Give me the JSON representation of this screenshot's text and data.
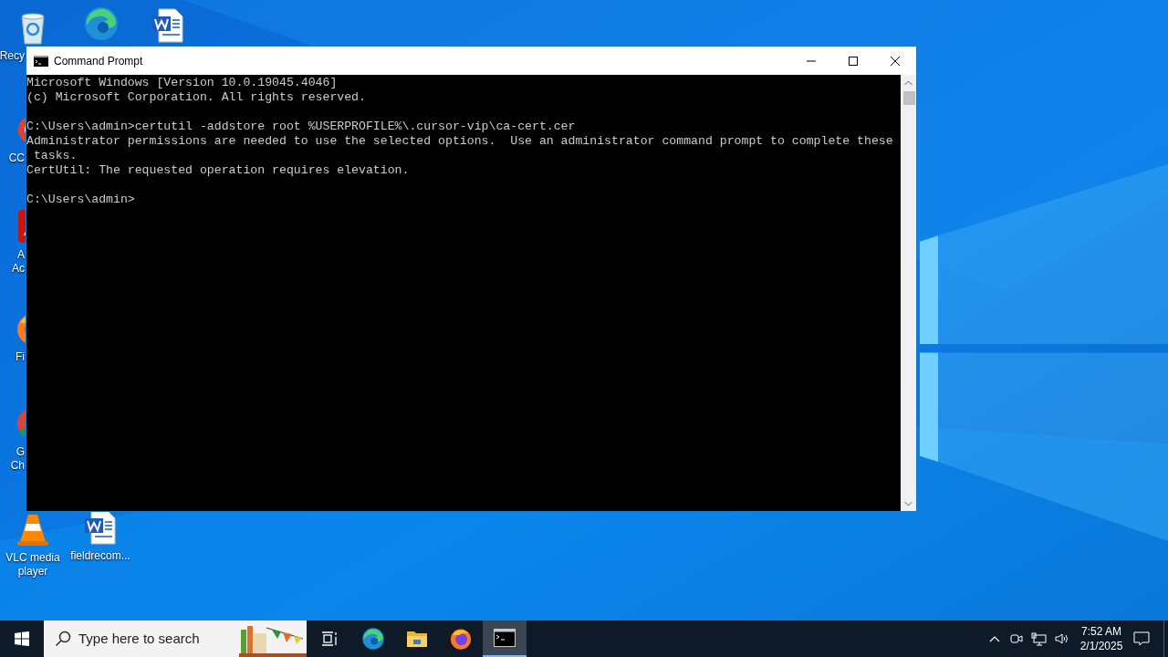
{
  "desktop": {
    "icons": [
      {
        "kind": "recycle-bin",
        "label_lines": [
          "Recy"
        ]
      },
      {
        "kind": "edge"
      },
      {
        "kind": "word"
      },
      {
        "kind": "ccleaner",
        "label_lines": [
          "CC"
        ]
      },
      {
        "kind": "acrobat",
        "label_lines": [
          "A",
          "Ac"
        ]
      },
      {
        "kind": "firefox",
        "label_lines": [
          "Fi"
        ]
      },
      {
        "kind": "chrome",
        "label_lines": [
          "G",
          "Ch"
        ]
      },
      {
        "kind": "vlc",
        "label_lines": [
          "VLC media",
          "player"
        ]
      },
      {
        "kind": "word",
        "label_lines": [
          "fieldrecom..."
        ]
      }
    ]
  },
  "window": {
    "title": "Command Prompt",
    "console_blocks": [
      [
        "Microsoft Windows [Version 10.0.19045.4046]",
        "(c) Microsoft Corporation. All rights reserved."
      ],
      [
        "C:\\Users\\admin>certutil -addstore root %USERPROFILE%\\.cursor-vip\\ca-cert.cer",
        "Administrator permissions are needed to use the selected options.  Use an administrator command prompt to complete these",
        " tasks.",
        "CertUtil: The requested operation requires elevation."
      ],
      [
        "C:\\Users\\admin>"
      ]
    ]
  },
  "taskbar": {
    "search": {
      "placeholder": "Type here to search"
    },
    "apps": [
      {
        "kind": "task-view",
        "selected": false
      },
      {
        "kind": "edge",
        "selected": false
      },
      {
        "kind": "explorer",
        "selected": false
      },
      {
        "kind": "firefox",
        "selected": false
      },
      {
        "kind": "cmd",
        "selected": true
      }
    ],
    "clock": {
      "time": "7:52 AM",
      "date": "2/1/2025"
    }
  }
}
